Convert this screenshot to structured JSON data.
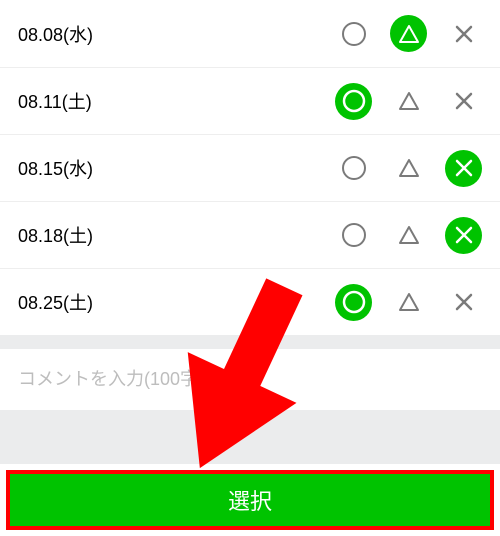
{
  "colors": {
    "accent": "#00c300",
    "highlight_border": "#ff0000",
    "placeholder": "#bdbdbd"
  },
  "option_symbols": {
    "circle": "○",
    "triangle": "△",
    "cross": "×"
  },
  "rows": [
    {
      "date": "08.08(水)",
      "selected": "triangle"
    },
    {
      "date": "08.11(土)",
      "selected": "circle"
    },
    {
      "date": "08.15(水)",
      "selected": "cross"
    },
    {
      "date": "08.18(土)",
      "selected": "cross"
    },
    {
      "date": "08.25(土)",
      "selected": "circle"
    }
  ],
  "comment": {
    "placeholder": "コメントを入力(100字以内)",
    "value": ""
  },
  "submit": {
    "label": "選択"
  }
}
